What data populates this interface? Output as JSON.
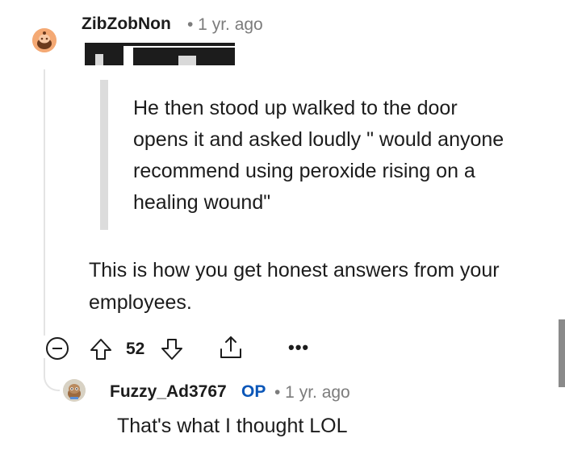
{
  "comment": {
    "username": "ZibZobNon",
    "timestamp": "• 1 yr. ago",
    "quote": "He then stood up walked to the door opens it and asked loudly \" would anyone recommend using peroxide rising on a healing wound\"",
    "body": "This is how you get honest answers from your employees.",
    "votes": "52",
    "more_label": "•••"
  },
  "reply": {
    "username": "Fuzzy_Ad3767",
    "op_badge": "OP",
    "timestamp": "• 1 yr. ago",
    "body": "That's what I thought LOL"
  },
  "icons": {
    "collapse": "collapse-minus-icon",
    "upvote": "arrow-up-icon",
    "downvote": "arrow-down-icon",
    "share": "share-icon"
  },
  "colors": {
    "op_badge": "#0a56b8",
    "muted_text": "#7c7c7c",
    "avatar_1": "#f4a974"
  }
}
